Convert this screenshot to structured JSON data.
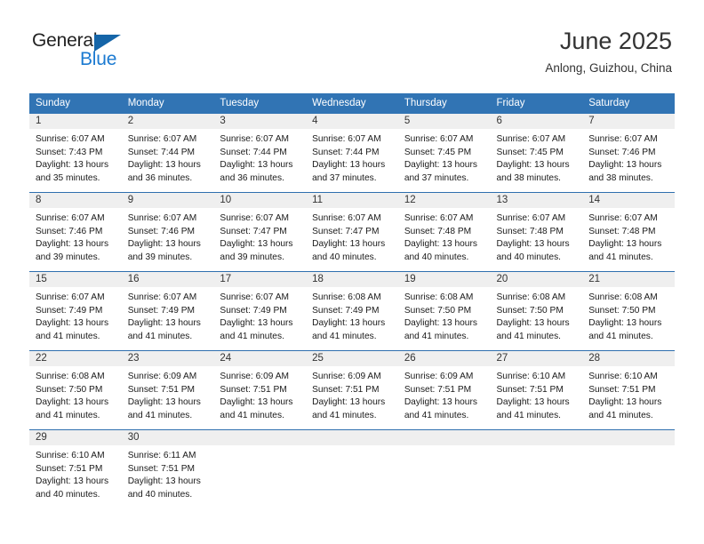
{
  "brand": {
    "name_part1": "General",
    "name_part2": "Blue",
    "accent_color": "#1b7ad1",
    "triangle_color": "#1565a8"
  },
  "header": {
    "title": "June 2025",
    "location": "Anlong, Guizhou, China"
  },
  "theme": {
    "header_bar_color": "#3174b4",
    "day_number_strip_color": "#efefef",
    "week_separator_color": "#2f6fae"
  },
  "weekdays": [
    "Sunday",
    "Monday",
    "Tuesday",
    "Wednesday",
    "Thursday",
    "Friday",
    "Saturday"
  ],
  "weeks": [
    [
      {
        "day": "1",
        "sunrise": "Sunrise: 6:07 AM",
        "sunset": "Sunset: 7:43 PM",
        "daylight_line1": "Daylight: 13 hours",
        "daylight_line2": "and 35 minutes."
      },
      {
        "day": "2",
        "sunrise": "Sunrise: 6:07 AM",
        "sunset": "Sunset: 7:44 PM",
        "daylight_line1": "Daylight: 13 hours",
        "daylight_line2": "and 36 minutes."
      },
      {
        "day": "3",
        "sunrise": "Sunrise: 6:07 AM",
        "sunset": "Sunset: 7:44 PM",
        "daylight_line1": "Daylight: 13 hours",
        "daylight_line2": "and 36 minutes."
      },
      {
        "day": "4",
        "sunrise": "Sunrise: 6:07 AM",
        "sunset": "Sunset: 7:44 PM",
        "daylight_line1": "Daylight: 13 hours",
        "daylight_line2": "and 37 minutes."
      },
      {
        "day": "5",
        "sunrise": "Sunrise: 6:07 AM",
        "sunset": "Sunset: 7:45 PM",
        "daylight_line1": "Daylight: 13 hours",
        "daylight_line2": "and 37 minutes."
      },
      {
        "day": "6",
        "sunrise": "Sunrise: 6:07 AM",
        "sunset": "Sunset: 7:45 PM",
        "daylight_line1": "Daylight: 13 hours",
        "daylight_line2": "and 38 minutes."
      },
      {
        "day": "7",
        "sunrise": "Sunrise: 6:07 AM",
        "sunset": "Sunset: 7:46 PM",
        "daylight_line1": "Daylight: 13 hours",
        "daylight_line2": "and 38 minutes."
      }
    ],
    [
      {
        "day": "8",
        "sunrise": "Sunrise: 6:07 AM",
        "sunset": "Sunset: 7:46 PM",
        "daylight_line1": "Daylight: 13 hours",
        "daylight_line2": "and 39 minutes."
      },
      {
        "day": "9",
        "sunrise": "Sunrise: 6:07 AM",
        "sunset": "Sunset: 7:46 PM",
        "daylight_line1": "Daylight: 13 hours",
        "daylight_line2": "and 39 minutes."
      },
      {
        "day": "10",
        "sunrise": "Sunrise: 6:07 AM",
        "sunset": "Sunset: 7:47 PM",
        "daylight_line1": "Daylight: 13 hours",
        "daylight_line2": "and 39 minutes."
      },
      {
        "day": "11",
        "sunrise": "Sunrise: 6:07 AM",
        "sunset": "Sunset: 7:47 PM",
        "daylight_line1": "Daylight: 13 hours",
        "daylight_line2": "and 40 minutes."
      },
      {
        "day": "12",
        "sunrise": "Sunrise: 6:07 AM",
        "sunset": "Sunset: 7:48 PM",
        "daylight_line1": "Daylight: 13 hours",
        "daylight_line2": "and 40 minutes."
      },
      {
        "day": "13",
        "sunrise": "Sunrise: 6:07 AM",
        "sunset": "Sunset: 7:48 PM",
        "daylight_line1": "Daylight: 13 hours",
        "daylight_line2": "and 40 minutes."
      },
      {
        "day": "14",
        "sunrise": "Sunrise: 6:07 AM",
        "sunset": "Sunset: 7:48 PM",
        "daylight_line1": "Daylight: 13 hours",
        "daylight_line2": "and 41 minutes."
      }
    ],
    [
      {
        "day": "15",
        "sunrise": "Sunrise: 6:07 AM",
        "sunset": "Sunset: 7:49 PM",
        "daylight_line1": "Daylight: 13 hours",
        "daylight_line2": "and 41 minutes."
      },
      {
        "day": "16",
        "sunrise": "Sunrise: 6:07 AM",
        "sunset": "Sunset: 7:49 PM",
        "daylight_line1": "Daylight: 13 hours",
        "daylight_line2": "and 41 minutes."
      },
      {
        "day": "17",
        "sunrise": "Sunrise: 6:07 AM",
        "sunset": "Sunset: 7:49 PM",
        "daylight_line1": "Daylight: 13 hours",
        "daylight_line2": "and 41 minutes."
      },
      {
        "day": "18",
        "sunrise": "Sunrise: 6:08 AM",
        "sunset": "Sunset: 7:49 PM",
        "daylight_line1": "Daylight: 13 hours",
        "daylight_line2": "and 41 minutes."
      },
      {
        "day": "19",
        "sunrise": "Sunrise: 6:08 AM",
        "sunset": "Sunset: 7:50 PM",
        "daylight_line1": "Daylight: 13 hours",
        "daylight_line2": "and 41 minutes."
      },
      {
        "day": "20",
        "sunrise": "Sunrise: 6:08 AM",
        "sunset": "Sunset: 7:50 PM",
        "daylight_line1": "Daylight: 13 hours",
        "daylight_line2": "and 41 minutes."
      },
      {
        "day": "21",
        "sunrise": "Sunrise: 6:08 AM",
        "sunset": "Sunset: 7:50 PM",
        "daylight_line1": "Daylight: 13 hours",
        "daylight_line2": "and 41 minutes."
      }
    ],
    [
      {
        "day": "22",
        "sunrise": "Sunrise: 6:08 AM",
        "sunset": "Sunset: 7:50 PM",
        "daylight_line1": "Daylight: 13 hours",
        "daylight_line2": "and 41 minutes."
      },
      {
        "day": "23",
        "sunrise": "Sunrise: 6:09 AM",
        "sunset": "Sunset: 7:51 PM",
        "daylight_line1": "Daylight: 13 hours",
        "daylight_line2": "and 41 minutes."
      },
      {
        "day": "24",
        "sunrise": "Sunrise: 6:09 AM",
        "sunset": "Sunset: 7:51 PM",
        "daylight_line1": "Daylight: 13 hours",
        "daylight_line2": "and 41 minutes."
      },
      {
        "day": "25",
        "sunrise": "Sunrise: 6:09 AM",
        "sunset": "Sunset: 7:51 PM",
        "daylight_line1": "Daylight: 13 hours",
        "daylight_line2": "and 41 minutes."
      },
      {
        "day": "26",
        "sunrise": "Sunrise: 6:09 AM",
        "sunset": "Sunset: 7:51 PM",
        "daylight_line1": "Daylight: 13 hours",
        "daylight_line2": "and 41 minutes."
      },
      {
        "day": "27",
        "sunrise": "Sunrise: 6:10 AM",
        "sunset": "Sunset: 7:51 PM",
        "daylight_line1": "Daylight: 13 hours",
        "daylight_line2": "and 41 minutes."
      },
      {
        "day": "28",
        "sunrise": "Sunrise: 6:10 AM",
        "sunset": "Sunset: 7:51 PM",
        "daylight_line1": "Daylight: 13 hours",
        "daylight_line2": "and 41 minutes."
      }
    ],
    [
      {
        "day": "29",
        "sunrise": "Sunrise: 6:10 AM",
        "sunset": "Sunset: 7:51 PM",
        "daylight_line1": "Daylight: 13 hours",
        "daylight_line2": "and 40 minutes."
      },
      {
        "day": "30",
        "sunrise": "Sunrise: 6:11 AM",
        "sunset": "Sunset: 7:51 PM",
        "daylight_line1": "Daylight: 13 hours",
        "daylight_line2": "and 40 minutes."
      },
      {
        "day": "",
        "sunrise": "",
        "sunset": "",
        "daylight_line1": "",
        "daylight_line2": ""
      },
      {
        "day": "",
        "sunrise": "",
        "sunset": "",
        "daylight_line1": "",
        "daylight_line2": ""
      },
      {
        "day": "",
        "sunrise": "",
        "sunset": "",
        "daylight_line1": "",
        "daylight_line2": ""
      },
      {
        "day": "",
        "sunrise": "",
        "sunset": "",
        "daylight_line1": "",
        "daylight_line2": ""
      },
      {
        "day": "",
        "sunrise": "",
        "sunset": "",
        "daylight_line1": "",
        "daylight_line2": ""
      }
    ]
  ]
}
